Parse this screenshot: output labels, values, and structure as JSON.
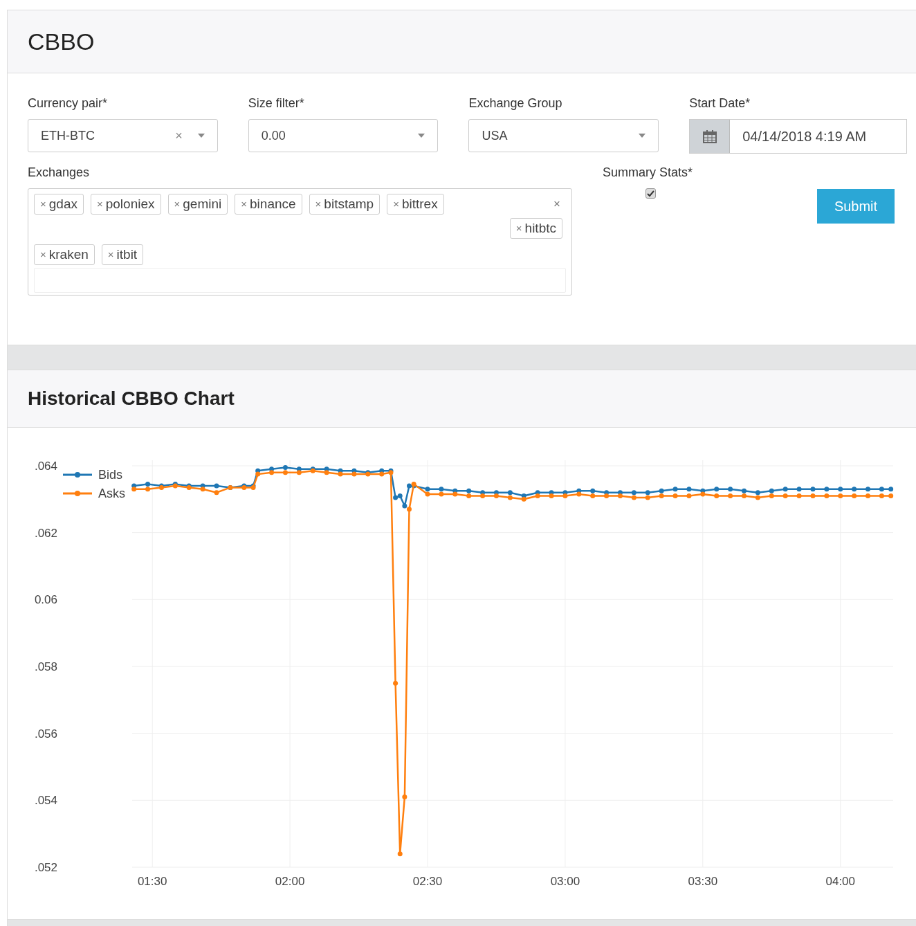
{
  "title": "CBBO",
  "form": {
    "currency_pair": {
      "label": "Currency pair*",
      "value": "ETH-BTC",
      "clear": "×"
    },
    "size_filter": {
      "label": "Size filter*",
      "value": "0.00"
    },
    "exchange_group": {
      "label": "Exchange Group",
      "value": "USA"
    },
    "start_date": {
      "label": "Start Date*",
      "value": "04/14/2018 4:19 AM"
    },
    "exchanges": {
      "label": "Exchanges",
      "clear": "×",
      "tags": [
        {
          "remove": "×",
          "label": "gdax"
        },
        {
          "remove": "×",
          "label": "poloniex"
        },
        {
          "remove": "×",
          "label": "gemini"
        },
        {
          "remove": "×",
          "label": "binance"
        },
        {
          "remove": "×",
          "label": "bitstamp"
        },
        {
          "remove": "×",
          "label": "bittrex"
        },
        {
          "remove": "×",
          "label": "hitbtc"
        },
        {
          "remove": "×",
          "label": "kraken"
        },
        {
          "remove": "×",
          "label": "itbit"
        }
      ]
    },
    "summary_stats": {
      "label": "Summary Stats*",
      "checked": true
    },
    "submit": "Submit"
  },
  "chart_section": {
    "title": "Historical CBBO Chart",
    "chart_data": {
      "type": "line",
      "x": [
        86,
        89,
        92,
        95,
        98,
        101,
        104,
        107,
        110,
        112,
        113,
        116,
        119,
        122,
        125,
        128,
        131,
        134,
        137,
        140,
        142,
        143,
        144,
        145,
        146,
        147,
        150,
        153,
        156,
        159,
        162,
        165,
        168,
        171,
        174,
        177,
        180,
        183,
        186,
        189,
        192,
        195,
        198,
        201,
        204,
        207,
        210,
        213,
        216,
        219,
        222,
        225,
        228,
        231,
        234,
        237,
        240,
        243,
        246,
        249,
        251
      ],
      "series": [
        {
          "name": "Bids",
          "color": "#1f77b4",
          "marker": "circle",
          "values": [
            0.0634,
            0.06345,
            0.0634,
            0.06345,
            0.0634,
            0.0634,
            0.0634,
            0.06335,
            0.0634,
            0.0634,
            0.06385,
            0.0639,
            0.06395,
            0.0639,
            0.0639,
            0.0639,
            0.06385,
            0.06385,
            0.0638,
            0.06385,
            0.06385,
            0.06305,
            0.0631,
            0.0628,
            0.0634,
            0.0634,
            0.0633,
            0.0633,
            0.06325,
            0.06325,
            0.0632,
            0.0632,
            0.0632,
            0.0631,
            0.0632,
            0.0632,
            0.0632,
            0.06325,
            0.06325,
            0.0632,
            0.0632,
            0.0632,
            0.0632,
            0.06325,
            0.0633,
            0.0633,
            0.06325,
            0.0633,
            0.0633,
            0.06325,
            0.0632,
            0.06325,
            0.0633,
            0.0633,
            0.0633,
            0.0633,
            0.0633,
            0.0633,
            0.0633,
            0.0633,
            0.0633
          ]
        },
        {
          "name": "Asks",
          "color": "#ff7f0e",
          "marker": "circle",
          "values": [
            0.0633,
            0.0633,
            0.06335,
            0.0634,
            0.06335,
            0.0633,
            0.0632,
            0.06335,
            0.06335,
            0.06335,
            0.06375,
            0.0638,
            0.0638,
            0.0638,
            0.06385,
            0.0638,
            0.06375,
            0.06375,
            0.06375,
            0.06375,
            0.0638,
            0.0575,
            0.0524,
            0.0541,
            0.0627,
            0.06345,
            0.06315,
            0.06315,
            0.06315,
            0.0631,
            0.0631,
            0.0631,
            0.06305,
            0.063,
            0.0631,
            0.0631,
            0.0631,
            0.06315,
            0.0631,
            0.0631,
            0.0631,
            0.06305,
            0.06305,
            0.0631,
            0.0631,
            0.0631,
            0.06315,
            0.0631,
            0.0631,
            0.0631,
            0.06305,
            0.0631,
            0.0631,
            0.0631,
            0.0631,
            0.0631,
            0.0631,
            0.0631,
            0.0631,
            0.0631,
            0.0631
          ]
        }
      ],
      "xlim": [
        85.6,
        251.5
      ],
      "ylim": [
        0.052,
        0.064
      ],
      "grid": true,
      "legend": true,
      "xticks": [
        {
          "value": 90,
          "label": "01:30"
        },
        {
          "value": 120,
          "label": "02:00"
        },
        {
          "value": 150,
          "label": "02:30"
        },
        {
          "value": 180,
          "label": "03:00"
        },
        {
          "value": 210,
          "label": "03:30"
        },
        {
          "value": 240,
          "label": "04:00"
        }
      ],
      "yticks": [
        {
          "value": 0.064,
          "label": ".064"
        },
        {
          "value": 0.062,
          "label": ".062"
        },
        {
          "value": 0.06,
          "label": "0.06"
        },
        {
          "value": 0.058,
          "label": ".058"
        },
        {
          "value": 0.056,
          "label": ".056"
        },
        {
          "value": 0.054,
          "label": ".054"
        },
        {
          "value": 0.052,
          "label": ".052"
        }
      ]
    }
  }
}
